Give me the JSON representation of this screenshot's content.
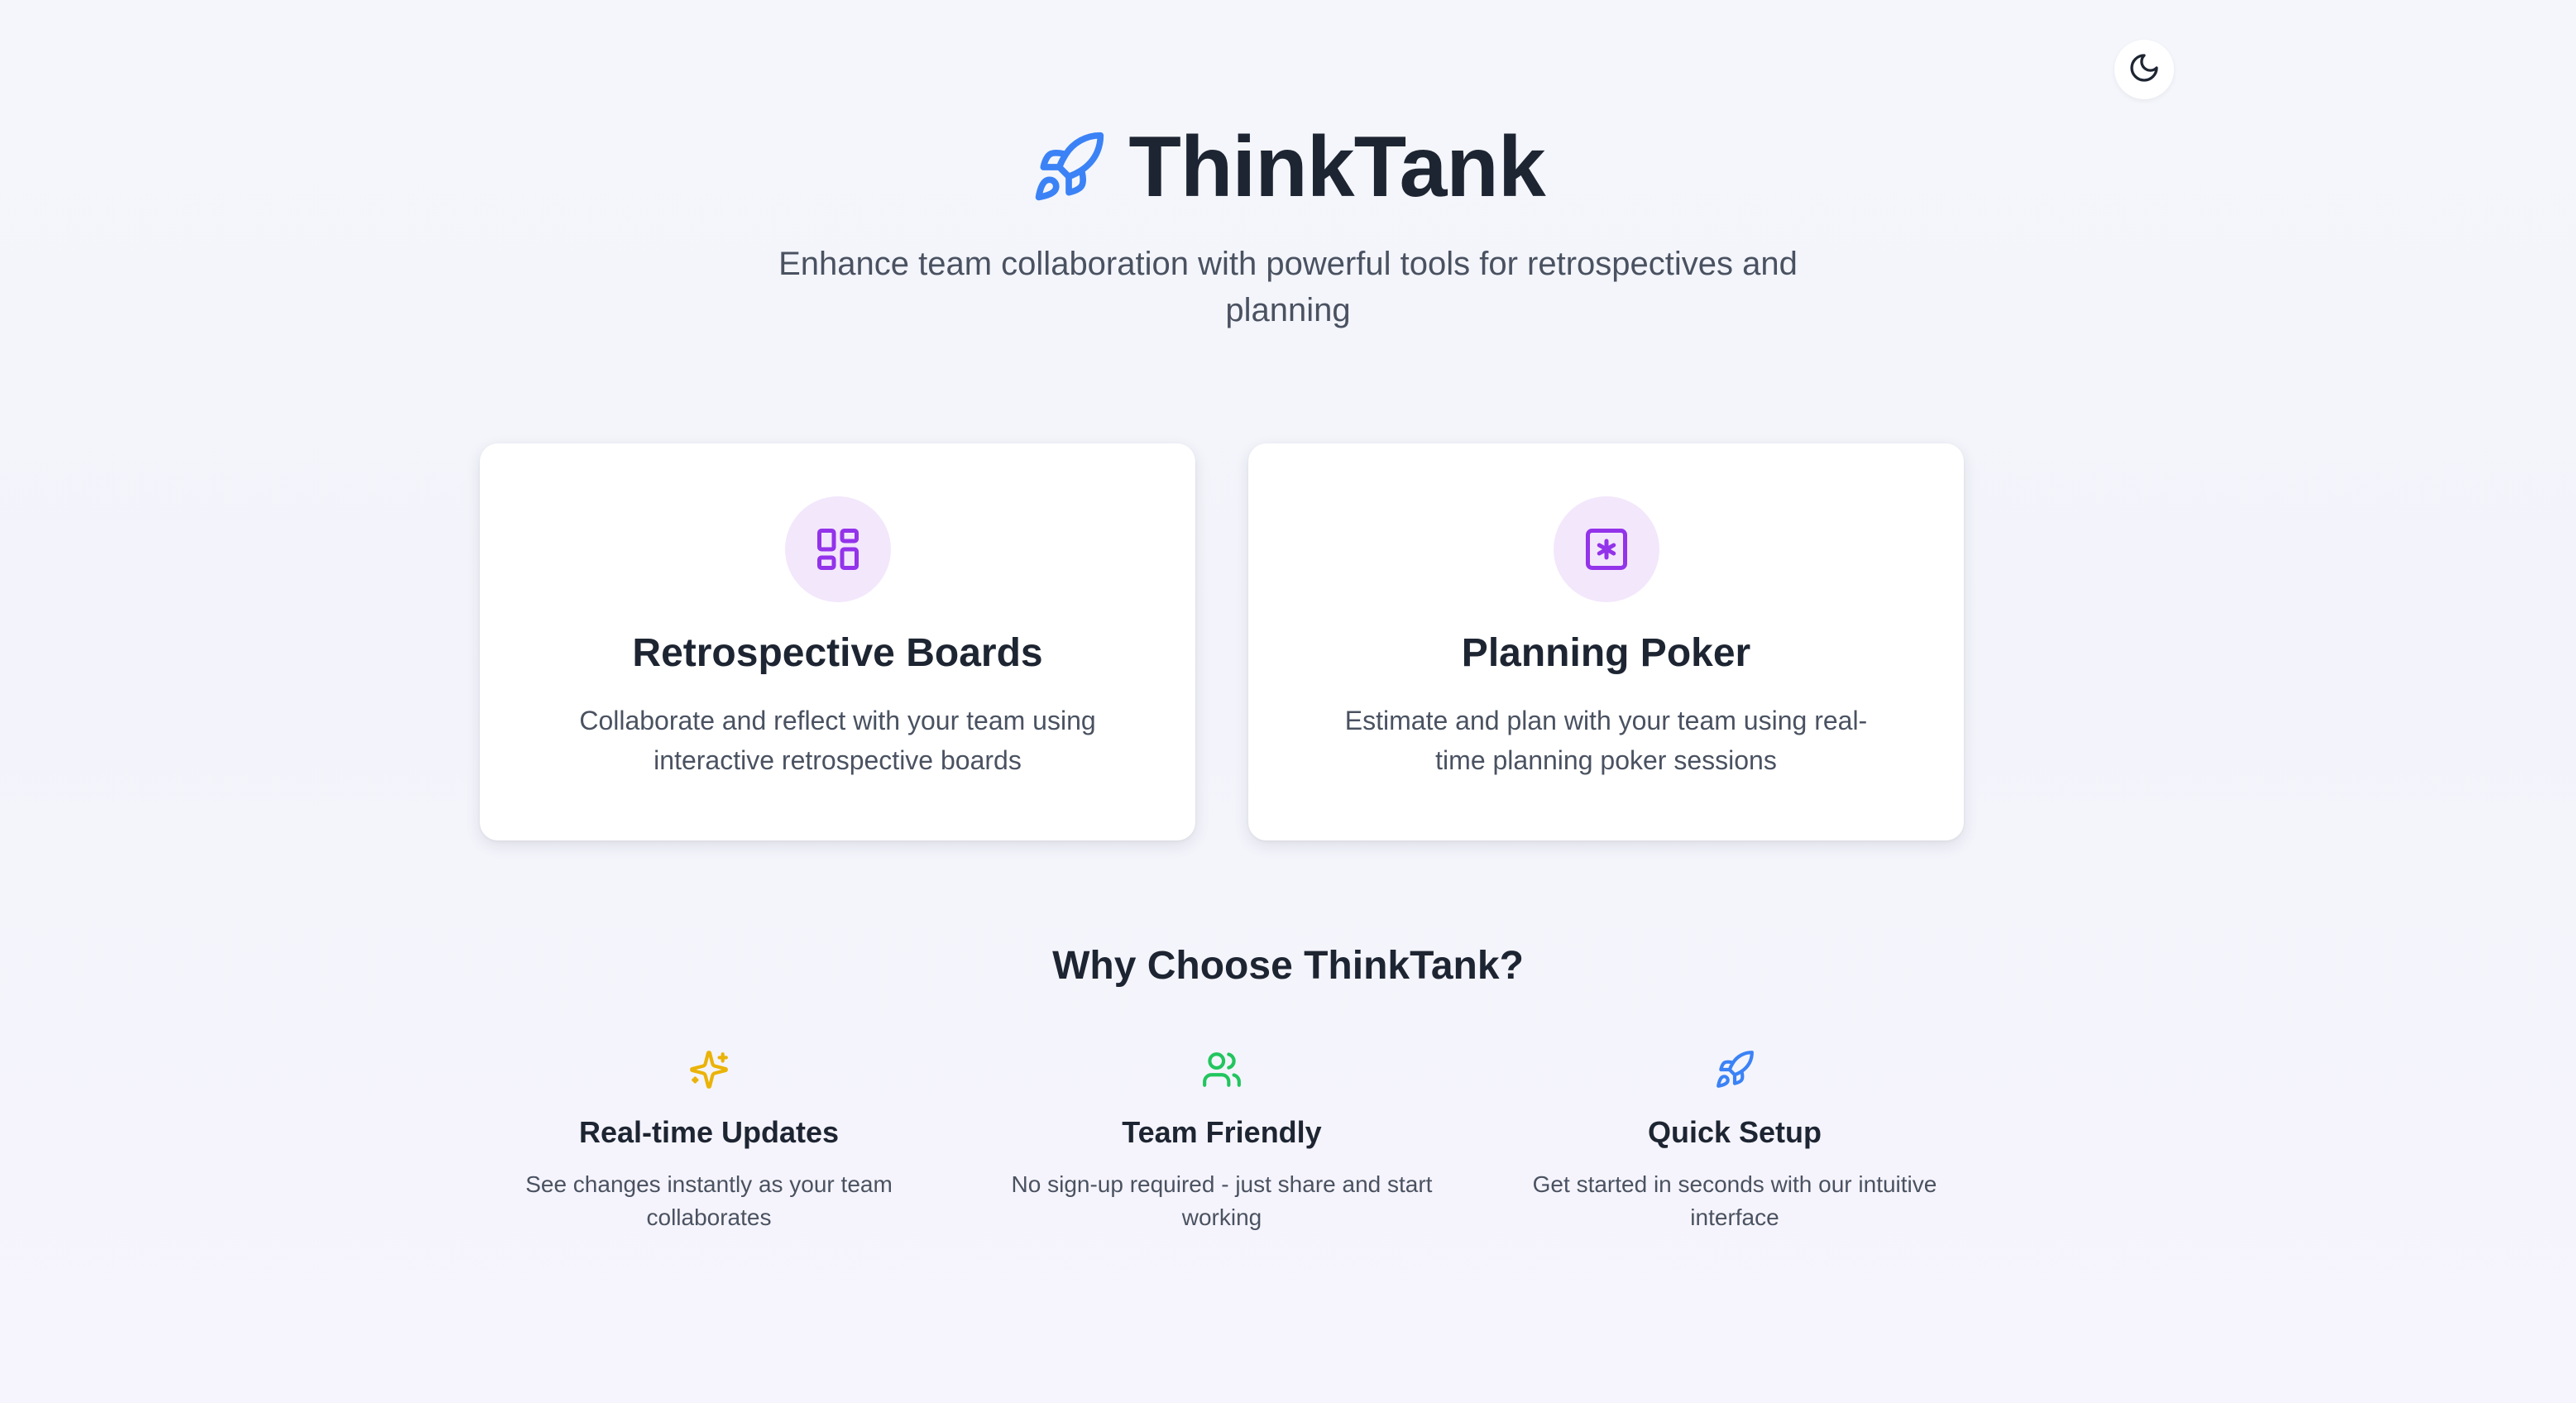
{
  "header": {
    "theme_toggle_icon": "moon-icon"
  },
  "hero": {
    "logo_icon": "rocket-icon",
    "title": "ThinkTank",
    "tagline": "Enhance team collaboration with powerful tools for retrospectives and planning"
  },
  "cards": [
    {
      "icon": "grid-layout-icon",
      "title": "Retrospective Boards",
      "description": "Collaborate and reflect with your team using interactive retrospective boards"
    },
    {
      "icon": "asterisk-square-icon",
      "title": "Planning Poker",
      "description": "Estimate and plan with your team using real-time planning poker sessions"
    }
  ],
  "why": {
    "heading": "Why Choose ThinkTank?",
    "features": [
      {
        "icon": "sparkles-icon",
        "title": "Real-time Updates",
        "description": "See changes instantly as your team collaborates"
      },
      {
        "icon": "users-icon",
        "title": "Team Friendly",
        "description": "No sign-up required - just share and start working"
      },
      {
        "icon": "rocket-icon",
        "title": "Quick Setup",
        "description": "Get started in seconds with our intuitive interface"
      }
    ]
  },
  "colors": {
    "brand_blue": "#3b82f6",
    "card_accent_purple": "#9333ea",
    "card_icon_bg": "#f3e7fc",
    "sparkle_yellow": "#eab308",
    "team_green": "#22c55e",
    "heading_text": "#1e2532",
    "body_text": "#4a5261"
  }
}
